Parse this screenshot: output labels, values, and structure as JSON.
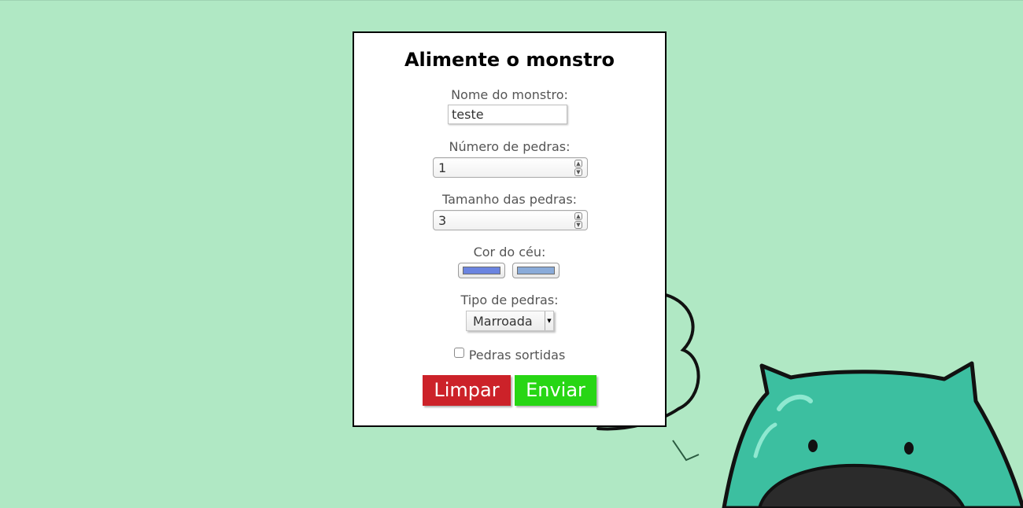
{
  "form": {
    "title": "Alimente o monstro",
    "monster_name": {
      "label": "Nome do monstro:",
      "value": "teste"
    },
    "stone_count": {
      "label": "Número de pedras:",
      "value": "1"
    },
    "stone_size": {
      "label": "Tamanho das pedras:",
      "value": "3"
    },
    "sky_color": {
      "label": "Cor do céu:",
      "colors": [
        "#6b84e0",
        "#8aabd9"
      ]
    },
    "stone_type": {
      "label": "Tipo de pedras:",
      "selected": "Marroada"
    },
    "mixed_stones": {
      "label": "Pedras sortidas",
      "checked": false
    },
    "buttons": {
      "clear": {
        "label": "Limpar",
        "color": "#cc2229"
      },
      "send": {
        "label": "Enviar",
        "color": "#27d614"
      }
    }
  },
  "background": {
    "color": "#b0e8c4",
    "monster_color": "#3cbfa0"
  }
}
